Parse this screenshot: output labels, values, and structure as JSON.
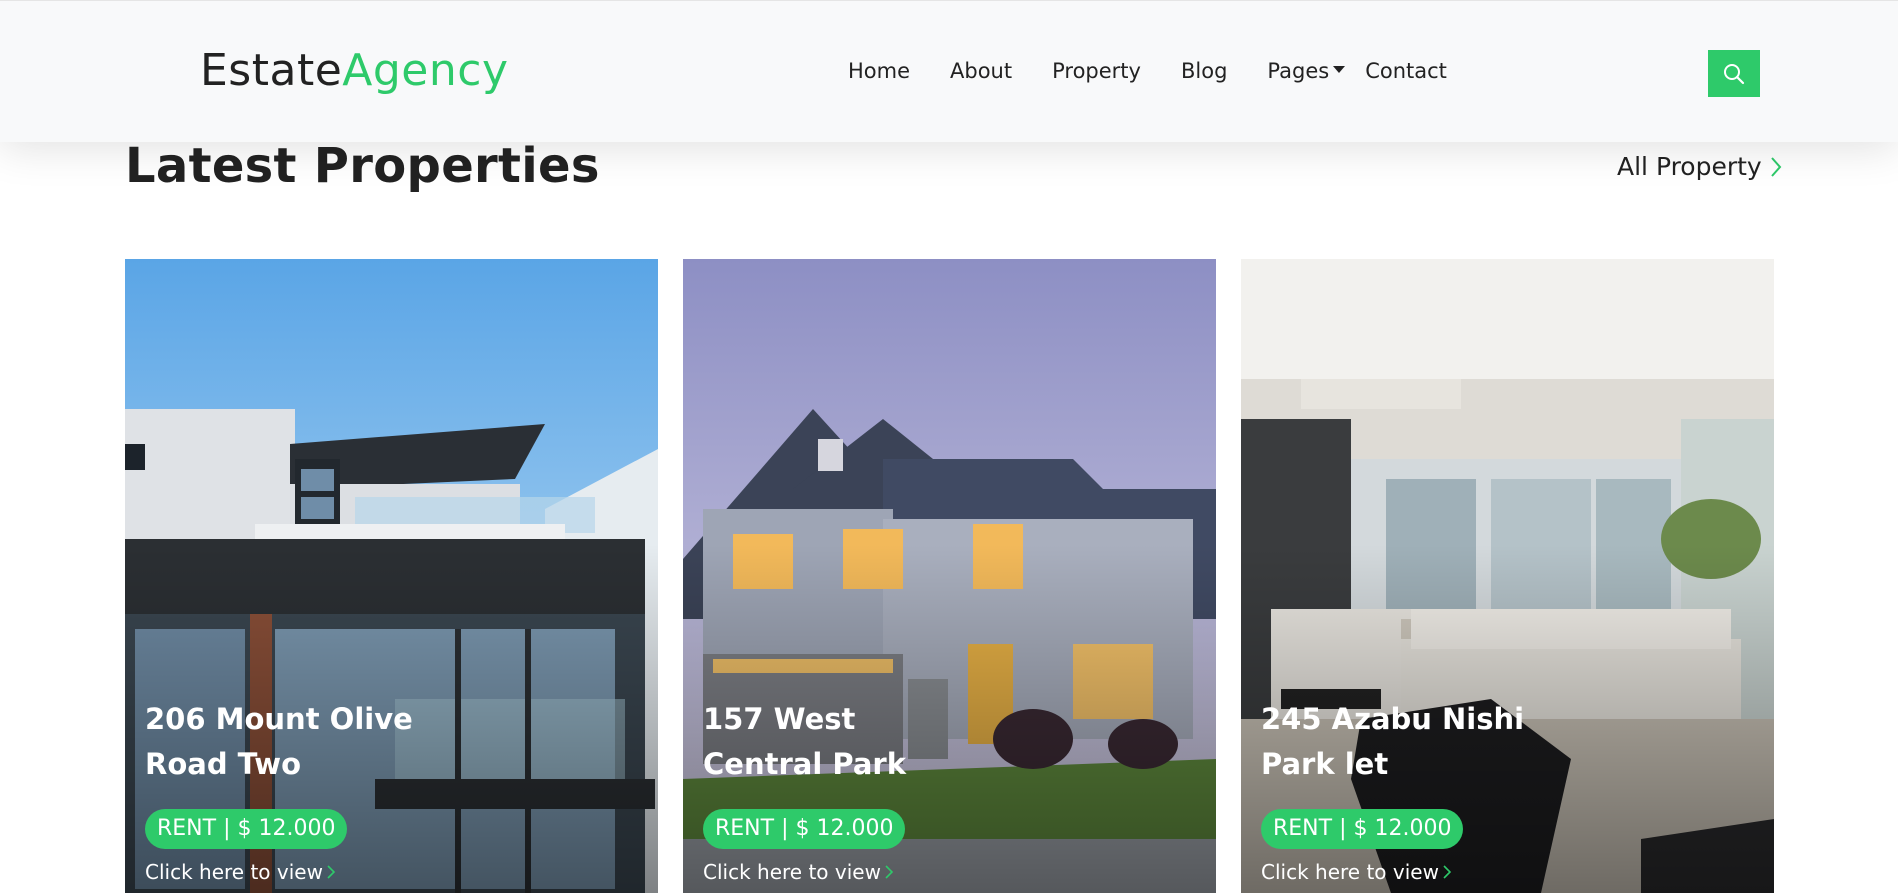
{
  "brand": {
    "first": "Estate",
    "second": "Agency"
  },
  "nav": {
    "items": [
      "Home",
      "About",
      "Property",
      "Blog"
    ],
    "pages_label": "Pages",
    "contact_label": "Contact"
  },
  "section": {
    "title": "Latest Properties",
    "all_link": "All Property"
  },
  "properties": [
    {
      "title_line1": "206 Mount Olive",
      "title_line2": "Road Two",
      "badge": "RENT | $ 12.000",
      "view_label": "Click here to view"
    },
    {
      "title_line1": "157 West",
      "title_line2": "Central Park",
      "badge": "RENT | $ 12.000",
      "view_label": "Click here to view"
    },
    {
      "title_line1": "245 Azabu Nishi",
      "title_line2": "Park let",
      "badge": "RENT | $ 12.000",
      "view_label": "Click here to view"
    }
  ],
  "colors": {
    "accent": "#2eca6a",
    "navbar_bg": "#f8f9fa",
    "text": "#222222"
  },
  "icons": {
    "search": "search-icon",
    "chevron": "chevron-right-icon",
    "caret": "caret-down-icon"
  }
}
